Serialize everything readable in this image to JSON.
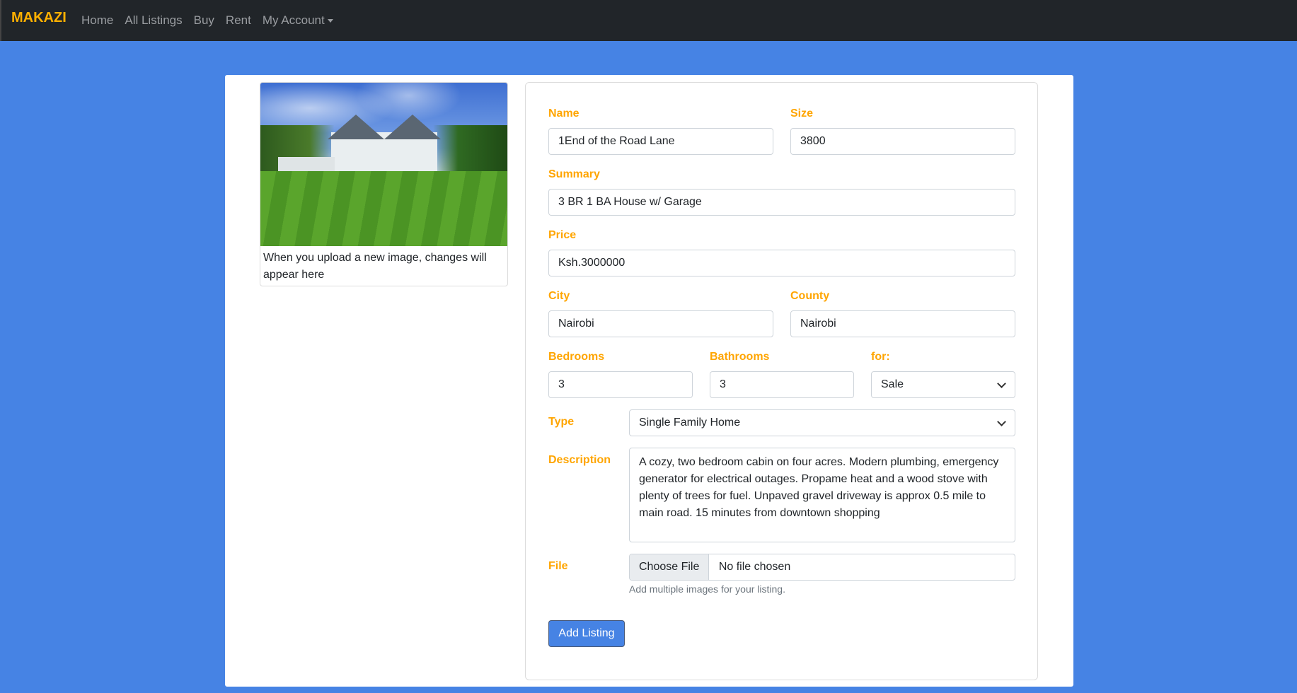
{
  "nav": {
    "brand": "MAKAZI",
    "links": [
      "Home",
      "All Listings",
      "Buy",
      "Rent",
      "My Account"
    ]
  },
  "preview": {
    "caption": "When you upload a new image, changes will appear here"
  },
  "form": {
    "name": {
      "label": "Name",
      "value": "1End of the Road Lane"
    },
    "size": {
      "label": "Size",
      "value": "3800"
    },
    "summary": {
      "label": "Summary",
      "value": "3 BR 1 BA House w/ Garage"
    },
    "price": {
      "label": "Price",
      "value": "Ksh.3000000"
    },
    "city": {
      "label": "City",
      "value": "Nairobi"
    },
    "county": {
      "label": "County",
      "value": "Nairobi"
    },
    "bedrooms": {
      "label": "Bedrooms",
      "value": "3"
    },
    "bathrooms": {
      "label": "Bathrooms",
      "value": "3"
    },
    "for": {
      "label": "for:",
      "value": "Sale"
    },
    "type": {
      "label": "Type",
      "value": "Single Family Home"
    },
    "description": {
      "label": "Description",
      "value": "A cozy, two bedroom cabin on four acres. Modern plumbing, emergency generator for electrical outages. Propame heat and a wood stove with plenty of trees for fuel. Unpaved gravel driveway is approx 0.5 mile to main road. 15 minutes from downtown shopping"
    },
    "file": {
      "label": "File",
      "button": "Choose File",
      "status": "No file chosen",
      "hint": "Add multiple images for your listing."
    },
    "submit": "Add Listing"
  },
  "colors": {
    "accent": "#ffa500",
    "background": "#4683e4",
    "navbar": "#212529"
  }
}
